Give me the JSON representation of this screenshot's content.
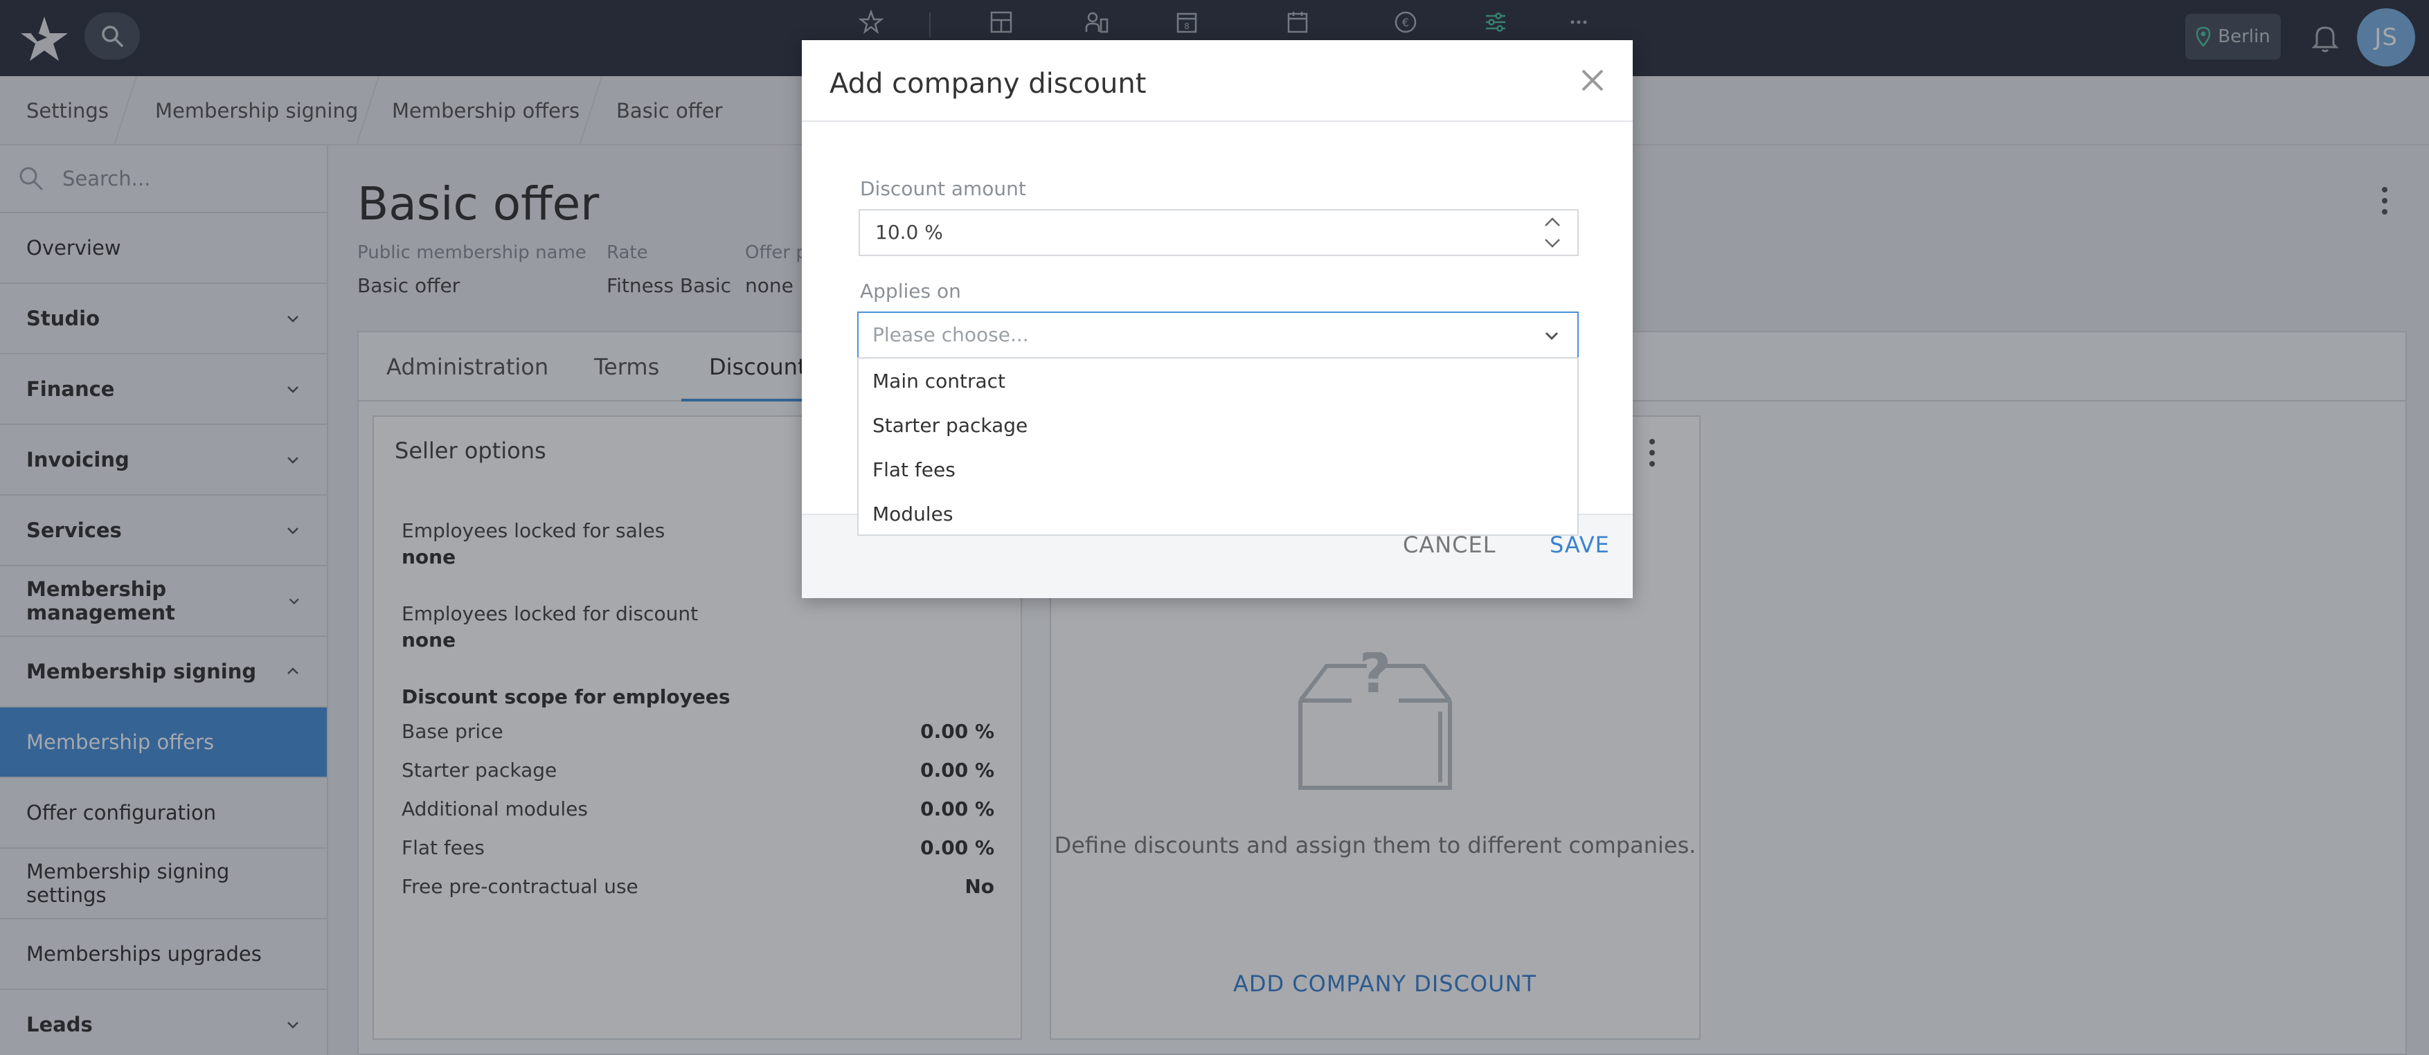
{
  "topbar": {
    "location_label": "Berlin",
    "avatar_initials": "JS",
    "nav_icons": [
      "star-icon",
      "layout-icon",
      "users-icon",
      "calendar-number-icon",
      "calendar-icon",
      "euro-icon",
      "sliders-icon",
      "more-icon"
    ],
    "accent": "#4fc3a1"
  },
  "breadcrumb": [
    "Settings",
    "Membership signing",
    "Membership offers",
    "Basic offer"
  ],
  "sidebar": {
    "search_placeholder": "Search...",
    "items": [
      {
        "label": "Overview"
      },
      {
        "label": "Studio"
      },
      {
        "label": "Finance"
      },
      {
        "label": "Invoicing"
      },
      {
        "label": "Services"
      },
      {
        "label": "Membership management"
      },
      {
        "label": "Membership signing"
      },
      {
        "label": "Membership offers"
      },
      {
        "label": "Offer configuration"
      },
      {
        "label": "Membership signing settings"
      },
      {
        "label": "Memberships upgrades"
      },
      {
        "label": "Leads"
      }
    ]
  },
  "page": {
    "title": "Basic offer",
    "meta": [
      {
        "label": "Public membership name",
        "value": "Basic offer"
      },
      {
        "label": "Rate",
        "value": "Fitness Basic"
      },
      {
        "label": "Offer p",
        "value": "none"
      }
    ],
    "tabs": [
      "Administration",
      "Terms",
      "Discounts"
    ]
  },
  "seller_options": {
    "title": "Seller options",
    "locked_sales_label": "Employees locked for sales",
    "locked_sales_value": "none",
    "locked_discount_label": "Employees locked for discount",
    "locked_discount_value": "none",
    "scope_title": "Discount scope for employees",
    "scope": [
      {
        "label": "Base price",
        "value": "0.00 %"
      },
      {
        "label": "Starter package",
        "value": "0.00 %"
      },
      {
        "label": "Additional modules",
        "value": "0.00 %"
      },
      {
        "label": "Flat fees",
        "value": "0.00 %"
      },
      {
        "label": "Free pre-contractual use",
        "value": "No"
      }
    ]
  },
  "company_discounts": {
    "empty_text": "Define discounts and assign them to different companies.",
    "add_label": "ADD COMPANY DISCOUNT"
  },
  "modal": {
    "title": "Add company discount",
    "discount_label": "Discount amount",
    "discount_value": "10.0 %",
    "applies_label": "Applies on",
    "applies_placeholder": "Please choose...",
    "options": [
      "Main contract",
      "Starter package",
      "Flat fees",
      "Modules"
    ],
    "cancel_label": "CANCEL",
    "save_label": "SAVE"
  }
}
